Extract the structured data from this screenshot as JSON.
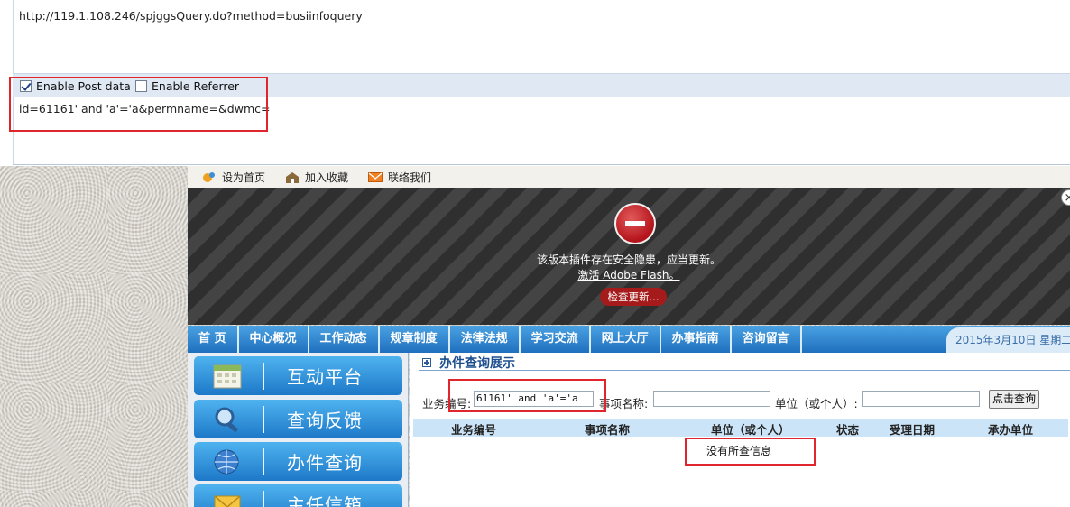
{
  "hackbar": {
    "url": "http://119.1.108.246/spjggsQuery.do?method=busiinfoquery",
    "enable_post_label": "Enable Post data",
    "enable_post_checked": true,
    "enable_referrer_label": "Enable Referrer",
    "enable_referrer_checked": false,
    "post_data": "id=61161' and 'a'='a&permname=&dwmc="
  },
  "toplinks": {
    "set_home": "设为首页",
    "add_fav": "加入收藏",
    "contact": "联络我们"
  },
  "flash": {
    "message": "该版本插件存在安全隐患，应当更新。",
    "activate_link": "激活 Adobe Flash。",
    "check_update": "检查更新...",
    "close": "×"
  },
  "nav": {
    "items": [
      "首 页",
      "中心概况",
      "工作动态",
      "规章制度",
      "法律法规",
      "学习交流",
      "网上大厅",
      "办事指南",
      "咨询留言"
    ],
    "date": "2015年3月10日 星期二"
  },
  "leftmenu": {
    "items": [
      "互动平台",
      "查询反馈",
      "办件查询",
      "主任信箱"
    ]
  },
  "content": {
    "section_title": "办件查询展示",
    "biz_no_label": "业务编号:",
    "biz_no_value": "61161' and 'a'='a",
    "item_name_label": "事项名称:",
    "item_name_value": "",
    "unit_label": "单位（或个人）:",
    "unit_value": "",
    "query_button": "点击查询",
    "table_headers": [
      "业务编号",
      "事项名称",
      "单位（或个人）",
      "状态",
      "受理日期",
      "承办单位"
    ],
    "no_data": "没有所查信息"
  },
  "colors": {
    "highlight": "#e0262c",
    "nav_blue": "#1f6fbe",
    "menu_blue": "#1d78c8"
  }
}
